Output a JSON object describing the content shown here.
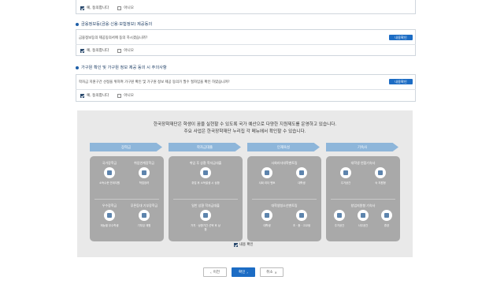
{
  "section0": {
    "yes": "예, 동의합니다",
    "no": "아니오"
  },
  "section1": {
    "title": "금융정보등(금융·신용·보험정보) 제공동의",
    "question": "금융정보등의 제공동의서에 동의 하시겠습니까?",
    "view_button": "내용확인",
    "yes": "예, 동의합니다",
    "no": "아니오"
  },
  "section2": {
    "title": "가구원 확인 및 가구원 정보 제공 동의 시 주의사항",
    "question": "학자금 지원구간 산정을 위하여 가구원 확인 및 가구원 정보 제공 동의가 필수 절차임을 확인 하였습니까?",
    "view_button": "내용확인",
    "yes": "예, 동의합니다",
    "no": "아니오"
  },
  "info": {
    "line1": "한국장학재단은 학생이 꿈을 실현할 수 있도록 국가 예산으로 다양한 지원제도를 운영하고 있습니다.",
    "line2": "주요 사업은 한국장학재단 누리집 각 메뉴에서 확인할 수 있습니다.",
    "columns": [
      {
        "header": "장학금",
        "top_title": "국가장학금",
        "top_title2": "취업연계장학금",
        "top_cap1": "소득수준 연계지원",
        "top_cap2": "학업장려",
        "bottom_title": "우수장학금",
        "bottom_title2": "푸른등대 기부장학금",
        "bottom_cap1": "재능별 우수학생",
        "bottom_cap2": "기부금 재원"
      },
      {
        "header": "학자금대출",
        "top_title": "취업 후 상환 학자금대출",
        "top_cap1": "취업 후 소득발생 시 상환",
        "bottom_title": "일반 상환 학자금대출",
        "bottom_cap1": "거치 · 상환기간 선택 후 상환"
      },
      {
        "header": "인재육성",
        "top_title": "사회리더대학멘토링",
        "top_cap1": "사회 리더 멘토",
        "top_cap2": "대학생",
        "bottom_title": "대학생청소년멘토링",
        "bottom_cap1": "대학생",
        "bottom_cap2": "초 · 중 · 고교생"
      },
      {
        "header": "기숙사",
        "top_title": "대학생 연합기숙사",
        "top_cap1": "주거공간",
        "top_cap2": "숙 지원형",
        "bottom_title": "창업지원형 기숙사",
        "bottom_cap1": "주거공간",
        "bottom_cap2": "사무공간",
        "bottom_cap3": "휴양"
      }
    ]
  },
  "agree_label": "내용 확인",
  "buttons": {
    "prev": "이전",
    "confirm": "확인",
    "cancel": "취소"
  },
  "colors": {
    "primary": "#1c6cc4",
    "header_arrow": "#8eb6da",
    "panel": "#e9e9e9",
    "card": "#a9a9a9"
  }
}
